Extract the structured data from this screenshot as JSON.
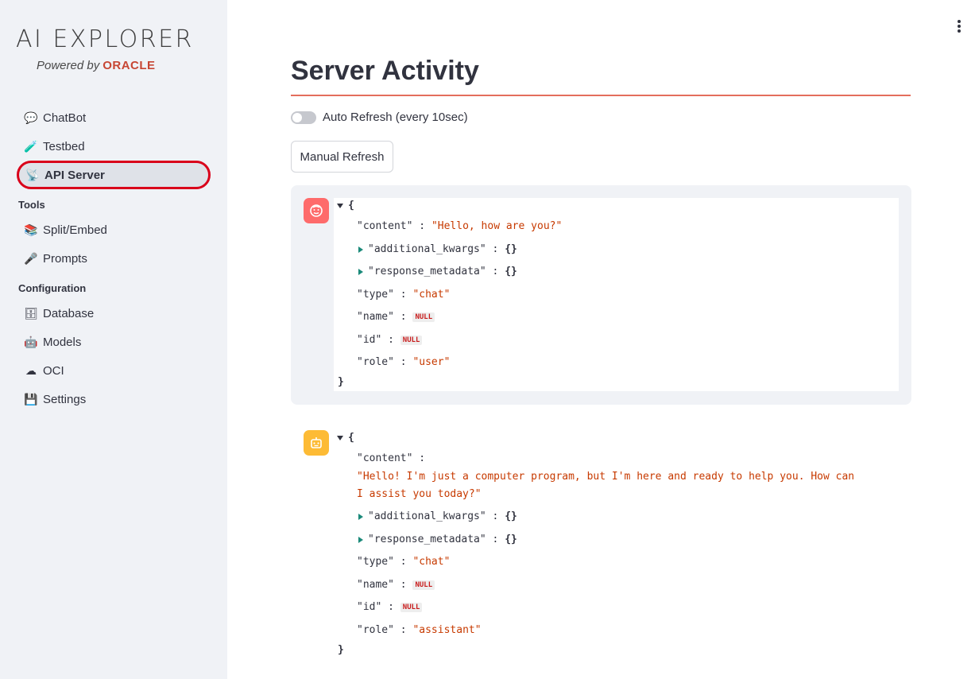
{
  "sidebar": {
    "logo_title": "AI EXPLORER",
    "logo_powered": "Powered by",
    "logo_brand": "ORACLE",
    "items": [
      {
        "label": "ChatBot",
        "icon": "speech-bubble-icon",
        "glyph": "💬"
      },
      {
        "label": "Testbed",
        "icon": "test-tube-icon",
        "glyph": "🧪"
      },
      {
        "label": "API Server",
        "icon": "satellite-dish-icon",
        "glyph": "📡",
        "active": true
      }
    ],
    "tools_label": "Tools",
    "tools": [
      {
        "label": "Split/Embed",
        "icon": "books-icon",
        "glyph": "📚"
      },
      {
        "label": "Prompts",
        "icon": "microphone-icon",
        "glyph": "🎤"
      }
    ],
    "config_label": "Configuration",
    "config": [
      {
        "label": "Database",
        "icon": "file-cabinet-icon",
        "glyph": "🗄"
      },
      {
        "label": "Models",
        "icon": "robot-icon",
        "glyph": "🤖"
      },
      {
        "label": "OCI",
        "icon": "cloud-icon",
        "glyph": "☁"
      },
      {
        "label": "Settings",
        "icon": "floppy-disk-icon",
        "glyph": "💾"
      }
    ]
  },
  "main": {
    "title": "Server Activity",
    "auto_refresh_label": "Auto Refresh (every 10sec)",
    "auto_refresh_on": false,
    "manual_refresh_label": "Manual Refresh",
    "accent_color": "#e46e5c"
  },
  "messages": [
    {
      "role_avatar": "user",
      "content": "\"Hello, how are you?\"",
      "additional_kwargs": "{}",
      "response_metadata": "{}",
      "type": "\"chat\"",
      "name": "NULL",
      "id": "NULL",
      "role": "\"user\""
    },
    {
      "role_avatar": "assistant",
      "content_line1": "\"Hello! I'm just a computer program, but I'm here and ready to help you. How can",
      "content_line2": "I assist you today?\"",
      "additional_kwargs": "{}",
      "response_metadata": "{}",
      "type": "\"chat\"",
      "name": "NULL",
      "id": "NULL",
      "role": "\"assistant\""
    }
  ],
  "json_keys": {
    "open": "{",
    "close": "}",
    "content": "\"content\"",
    "additional_kwargs": "\"additional_kwargs\"",
    "response_metadata": "\"response_metadata\"",
    "type": "\"type\"",
    "name": "\"name\"",
    "id": "\"id\"",
    "role": "\"role\"",
    "colon": ":"
  }
}
